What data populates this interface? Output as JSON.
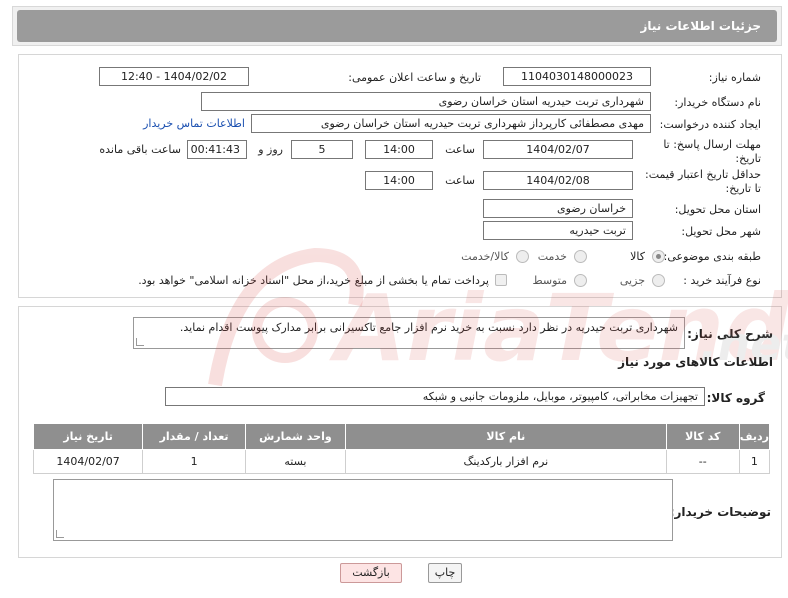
{
  "header": {
    "title": "جزئیات اطلاعات نیاز"
  },
  "form": {
    "need_number_label": "شماره نیاز:",
    "need_number": "1104030148000023",
    "announce_label": "تاریخ و ساعت اعلان عمومی:",
    "announce_value": "1404/02/02 - 12:40",
    "buyer_org_label": "نام دستگاه خریدار:",
    "buyer_org": "شهرداری تربت حیدریه استان خراسان رضوی",
    "creator_label": "ایجاد کننده درخواست:",
    "creator": "مهدی مصطفائی کارپرداز شهرداری تربت حیدریه استان خراسان رضوی",
    "contact_link": "اطلاعات تماس خریدار",
    "deadline_label": "مهلت ارسال پاسخ: تا تاریخ:",
    "deadline_date": "1404/02/07",
    "time_label": "ساعت",
    "deadline_time": "14:00",
    "days_value": "5",
    "days_label": "روز و",
    "remaining_time": "00:41:43",
    "remaining_label": "ساعت باقی مانده",
    "price_validity_label": "حداقل تاریخ اعتبار قیمت: تا تاریخ:",
    "price_validity_date": "1404/02/08",
    "price_validity_time": "14:00",
    "province_label": "استان محل تحویل:",
    "province": "خراسان رضوی",
    "city_label": "شهر محل تحویل:",
    "city": "تربت حیدریه",
    "category_label": "طبقه بندی موضوعی:",
    "category_options": [
      "کالا",
      "خدمت",
      "کالا/خدمت"
    ],
    "process_label": "نوع فرآیند خرید :",
    "process_options": [
      "جزیی",
      "متوسط"
    ],
    "payment_note": "پرداخت تمام یا بخشی از مبلغ خرید،از محل \"اسناد خزانه اسلامی\" خواهد بود."
  },
  "details": {
    "description_label": "شرح کلی نیاز:",
    "description": "شهرداری تربت حیدریه در نظر دارد نسبت به خرید نرم افزار جامع تاکسیرانی برابر مدارک پیوست اقدام نماید.",
    "goods_section_title": "اطلاعات کالاهای مورد نیاز",
    "goods_group_label": "گروه کالا:",
    "goods_group": "تجهیزات مخابراتی، کامپیوتر، موبایل، ملزومات جانبی و شبکه",
    "table_headers": [
      "ردیف",
      "کد کالا",
      "نام کالا",
      "واحد شمارش",
      "تعداد / مقدار",
      "تاریخ نیاز"
    ],
    "table_rows": [
      [
        "1",
        "--",
        "نرم افزار بارکدینگ",
        "بسته",
        "1",
        "1404/02/07"
      ]
    ],
    "buyer_notes_label": "توضیحات خریدار:"
  },
  "buttons": {
    "print": "چاپ",
    "back": "بازگشت"
  },
  "colors": {
    "header_bg": "#9b9b9b",
    "link": "#1a4fb0",
    "watermark": "#d9534f"
  }
}
